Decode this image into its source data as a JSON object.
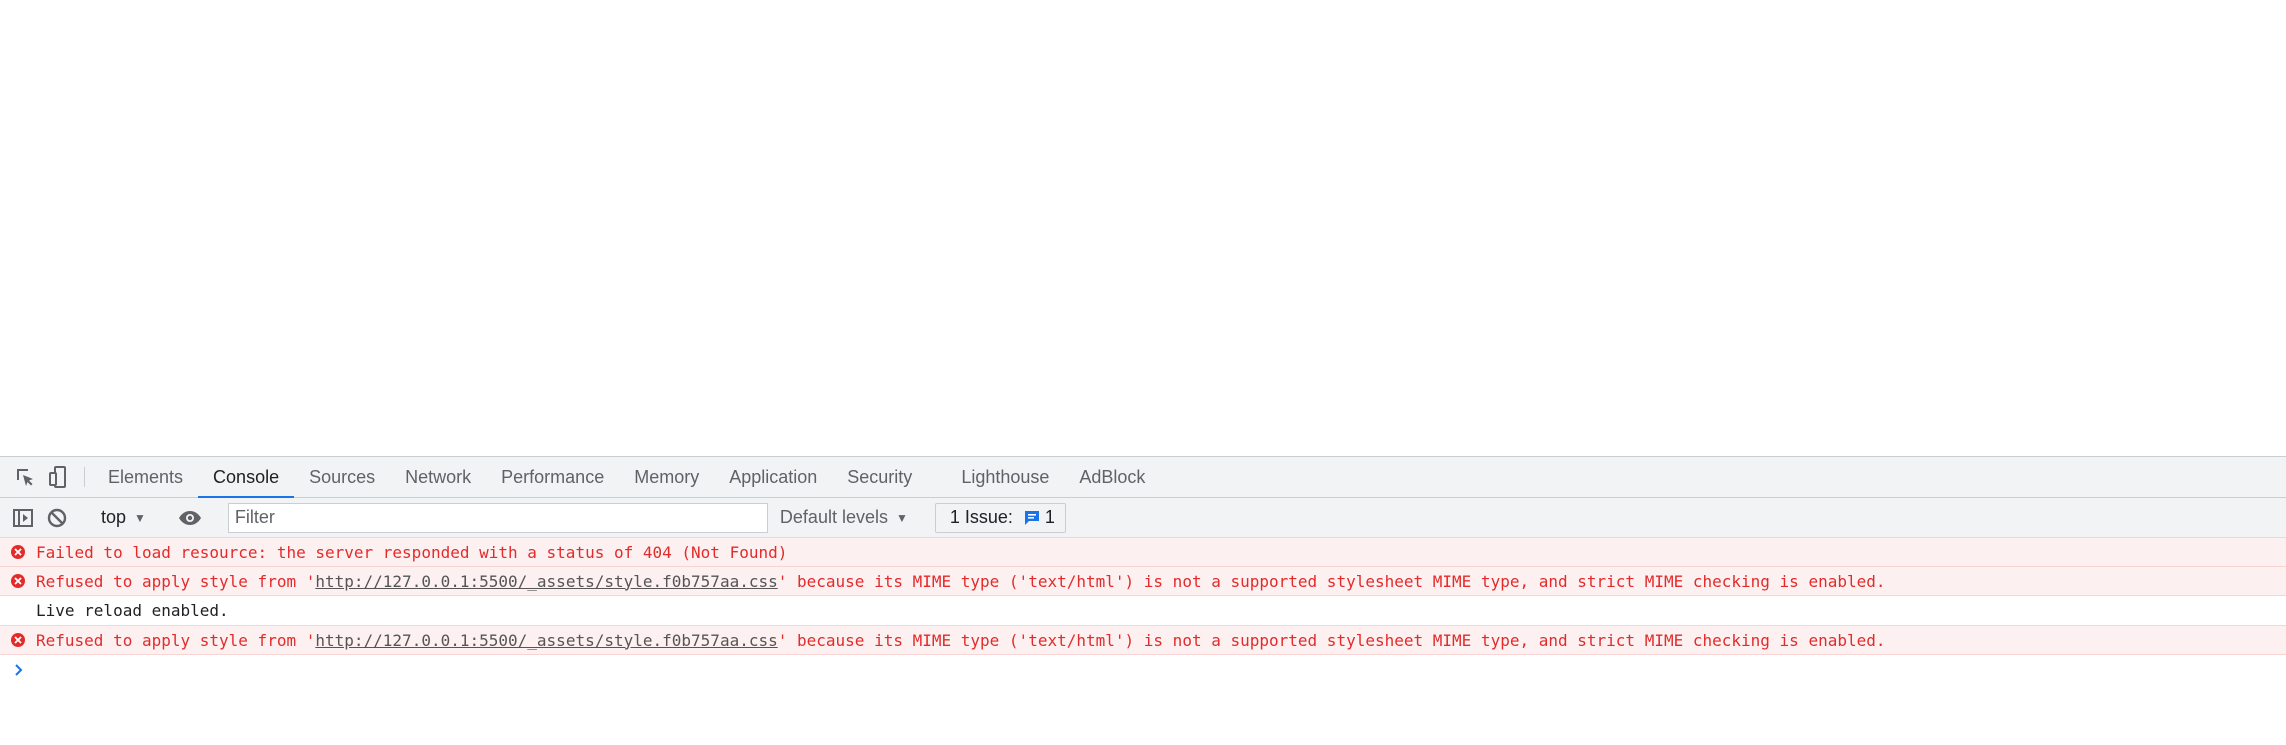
{
  "devtools": {
    "tabs": [
      {
        "label": "Elements"
      },
      {
        "label": "Console"
      },
      {
        "label": "Sources"
      },
      {
        "label": "Network"
      },
      {
        "label": "Performance"
      },
      {
        "label": "Memory"
      },
      {
        "label": "Application"
      },
      {
        "label": "Security"
      },
      {
        "label": "Lighthouse"
      },
      {
        "label": "AdBlock"
      }
    ],
    "active_tab": "Console",
    "toolbar": {
      "context": "top",
      "filter_placeholder": "Filter",
      "filter_value": "",
      "levels_label": "Default levels",
      "issues_label": "1 Issue:",
      "issues_count": "1"
    },
    "messages": [
      {
        "type": "error",
        "pre": "Failed to load resource: the server responded with a status of 404 (Not Found)",
        "link": "",
        "post": ""
      },
      {
        "type": "error",
        "pre": "Refused to apply style from '",
        "link": "http://127.0.0.1:5500/_assets/style.f0b757aa.css",
        "post": "' because its MIME type ('text/html') is not a supported stylesheet MIME type, and strict MIME checking is enabled."
      },
      {
        "type": "info",
        "pre": "Live reload enabled.",
        "link": "",
        "post": ""
      },
      {
        "type": "error",
        "pre": "Refused to apply style from '",
        "link": "http://127.0.0.1:5500/_assets/style.f0b757aa.css",
        "post": "' because its MIME type ('text/html') is not a supported stylesheet MIME type, and strict MIME checking is enabled."
      }
    ],
    "colors": {
      "accent": "#1a73e8",
      "error_text": "#e32b2b",
      "error_bg": "#fcf0f0",
      "toolbar_bg": "#f1f3f4"
    }
  }
}
